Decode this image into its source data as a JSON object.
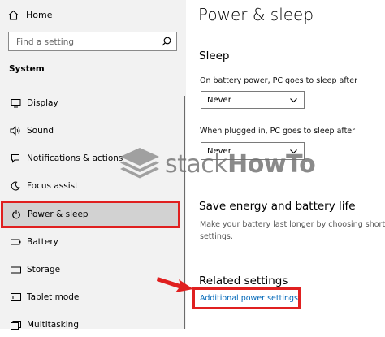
{
  "sidebar": {
    "home_label": "Home",
    "search_placeholder": "Find a setting",
    "section_label": "System",
    "items": [
      {
        "label": "Display",
        "icon": "display-icon"
      },
      {
        "label": "Sound",
        "icon": "speaker-icon"
      },
      {
        "label": "Notifications & actions",
        "icon": "notification-icon"
      },
      {
        "label": "Focus assist",
        "icon": "moon-icon"
      },
      {
        "label": "Power & sleep",
        "icon": "power-icon",
        "active": true
      },
      {
        "label": "Battery",
        "icon": "battery-icon"
      },
      {
        "label": "Storage",
        "icon": "storage-icon"
      },
      {
        "label": "Tablet mode",
        "icon": "tablet-icon"
      },
      {
        "label": "Multitasking",
        "icon": "multitasking-icon"
      }
    ]
  },
  "main": {
    "title": "Power & sleep",
    "sleep_heading": "Sleep",
    "battery_label": "On battery power, PC goes to sleep after",
    "battery_value": "Never",
    "plugged_label": "When plugged in, PC goes to sleep after",
    "plugged_value": "Never",
    "energy_heading": "Save energy and battery life",
    "energy_desc_line1": "Make your battery last longer by choosing shorter ti",
    "energy_desc_line2": "settings.",
    "related_heading": "Related settings",
    "related_link": "Additional power settings"
  },
  "watermark": {
    "text_light": "stack",
    "text_bold": "HowTo"
  },
  "colors": {
    "highlight": "#e02020",
    "link": "#0067b8",
    "sidebar_bg": "#f2f2f2"
  }
}
